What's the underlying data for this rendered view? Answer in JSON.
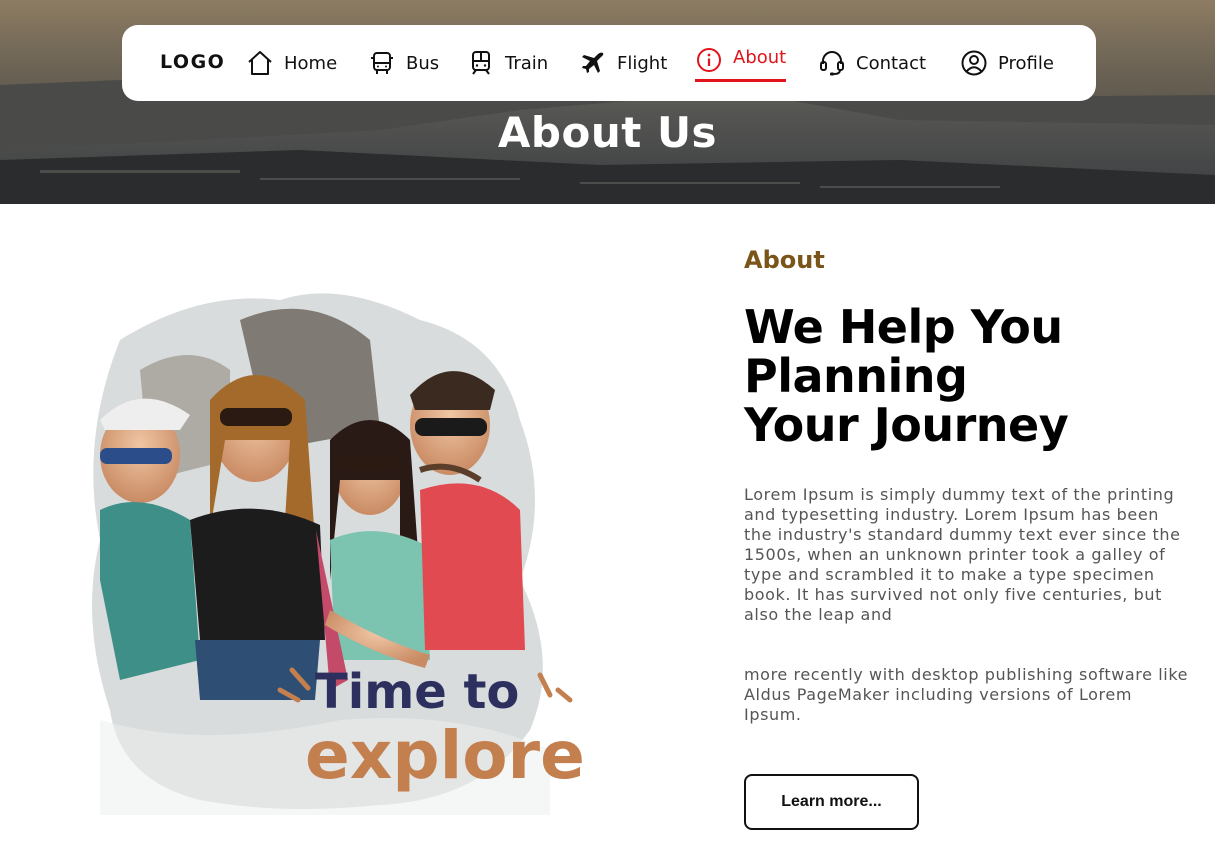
{
  "hero": {
    "title": "About Us"
  },
  "navbar": {
    "logo": "LOGO",
    "items": [
      {
        "label": "Home",
        "icon": "home-icon"
      },
      {
        "label": "Bus",
        "icon": "bus-icon"
      },
      {
        "label": "Train",
        "icon": "train-icon"
      },
      {
        "label": "Flight",
        "icon": "airplane-icon"
      },
      {
        "label": "About",
        "icon": "info-icon",
        "active": true
      },
      {
        "label": "Contact",
        "icon": "headset-icon"
      },
      {
        "label": "Profile",
        "icon": "user-circle-icon"
      }
    ],
    "active_color": "#e0141a"
  },
  "about": {
    "label": "About",
    "label_color": "#7a5418",
    "headline": [
      "We Help You",
      "Planning",
      "Your Journey"
    ],
    "paragraph1": "Lorem Ipsum is simply dummy text of the printing and typesetting industry. Lorem Ipsum has been the industry's standard dummy text ever since the 1500s, when an unknown printer took a galley of type and scrambled it to make a type specimen book. It has survived not only five centuries, but also the leap and",
    "paragraph2": "more recently with desktop publishing software like Aldus PageMaker including versions of Lorem Ipsum.",
    "button": "Learn more..."
  },
  "photo": {
    "caption_line1": "Time to",
    "caption_line2": "explore",
    "caption_color1": "#2d2f5e",
    "caption_color2": "#c47f4e"
  }
}
